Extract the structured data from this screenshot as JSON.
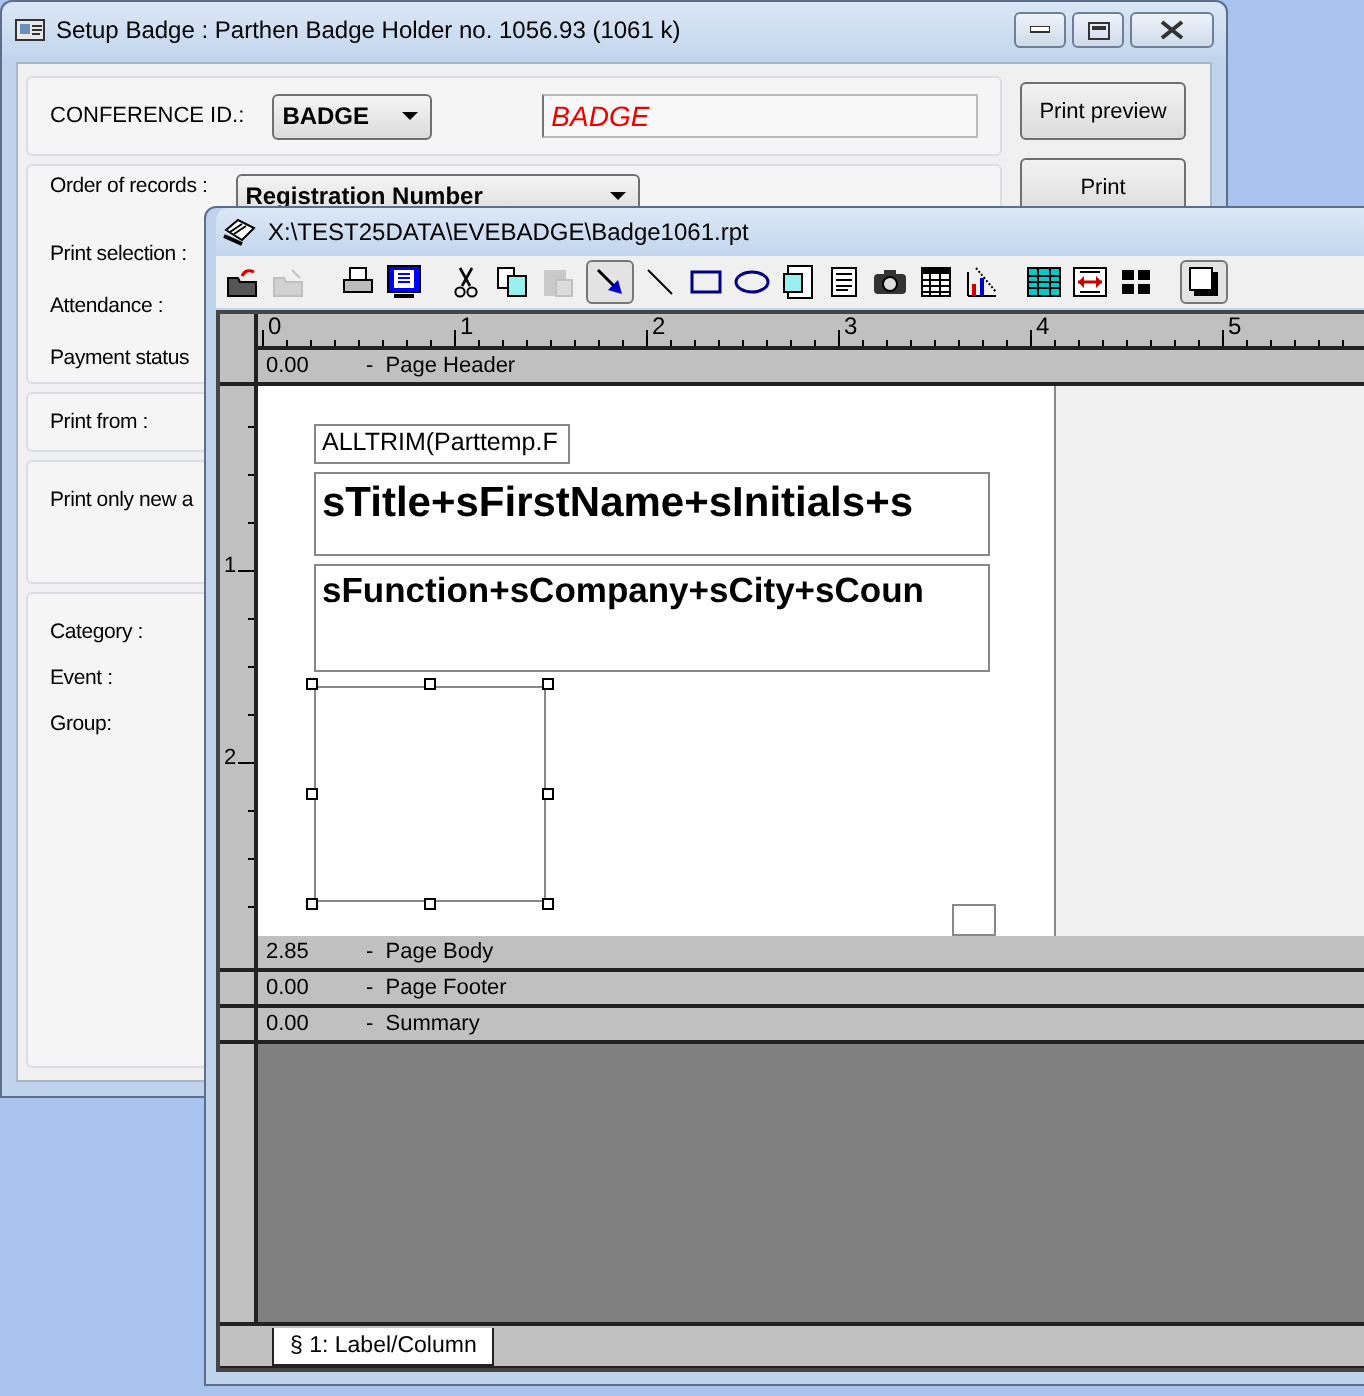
{
  "setup_window": {
    "title": "Setup Badge : Parthen Badge Holder no. 1056.93 (1061 k)",
    "conference": {
      "label": "CONFERENCE ID.:",
      "value": "BADGE",
      "preview": "BADGE"
    },
    "order": {
      "label": "Order of records :",
      "value": "Registration Number"
    },
    "order_labels": [
      "Print selection :",
      "Attendance :",
      "Payment status"
    ],
    "groups": [
      [
        "Print from :"
      ],
      [
        "Print only new a"
      ],
      [
        "Category :",
        "Event :",
        "Group:"
      ]
    ],
    "buttons": [
      "Print preview",
      "Print"
    ]
  },
  "report_window": {
    "title": "X:\\TEST25DATA\\EVEBADGE\\Badge1061.rpt",
    "toolbar": [
      {
        "kind": "new",
        "pressed": false,
        "disabled": false
      },
      {
        "kind": "open",
        "pressed": false,
        "disabled": true
      },
      {
        "kind": "print",
        "pressed": false,
        "disabled": false
      },
      {
        "kind": "preview",
        "pressed": false,
        "disabled": false
      },
      {
        "kind": "cut",
        "pressed": false,
        "disabled": false
      },
      {
        "kind": "copy",
        "pressed": false,
        "disabled": false
      },
      {
        "kind": "paste",
        "pressed": false,
        "disabled": true
      },
      {
        "kind": "pointer",
        "pressed": true,
        "disabled": false
      },
      {
        "kind": "line",
        "pressed": false,
        "disabled": false
      },
      {
        "kind": "rectangle",
        "pressed": false,
        "disabled": false
      },
      {
        "kind": "ellipse",
        "pressed": false,
        "disabled": false
      },
      {
        "kind": "image",
        "pressed": false,
        "disabled": false
      },
      {
        "kind": "text",
        "pressed": false,
        "disabled": false
      },
      {
        "kind": "camera",
        "pressed": false,
        "disabled": false
      },
      {
        "kind": "table",
        "pressed": false,
        "disabled": false
      },
      {
        "kind": "chart",
        "pressed": false,
        "disabled": false
      },
      {
        "kind": "grid",
        "pressed": false,
        "disabled": false
      },
      {
        "kind": "band",
        "pressed": false,
        "disabled": false
      },
      {
        "kind": "layout",
        "pressed": false,
        "disabled": false
      },
      {
        "kind": "shadow",
        "pressed": true,
        "disabled": false
      }
    ],
    "ruler": [
      "0",
      "1",
      "2",
      "3",
      "4",
      "5"
    ],
    "vruler": [
      "1",
      "2"
    ],
    "bands": [
      {
        "size": "0.00",
        "name": "-  Page Header"
      },
      {
        "size": "2.85",
        "name": "-  Page Body"
      },
      {
        "size": "0.00",
        "name": "-  Page Footer"
      },
      {
        "size": "0.00",
        "name": "-  Summary"
      }
    ],
    "fields": [
      {
        "kind": "small",
        "text": "ALLTRIM(Parttemp.F"
      },
      {
        "kind": "large",
        "text": "sTitle+sFirstName+sInitials+s"
      },
      {
        "kind": "medium",
        "text": "sFunction+sCompany+sCity+sCoun"
      }
    ],
    "shapes": [
      {
        "kind": "rectangle",
        "selected": true
      },
      {
        "kind": "square",
        "selected": false
      }
    ],
    "tabs": [
      {
        "label": "§ 1: Label/Column",
        "selected": true
      }
    ]
  }
}
